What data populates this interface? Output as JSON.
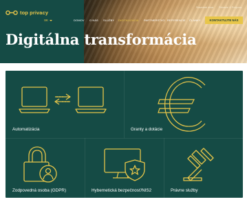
{
  "brand": {
    "name": "top privacy",
    "logo_icon": "key-icon",
    "accent": "#e8c64a",
    "primary": "#154b45"
  },
  "language": {
    "current": "SK",
    "icon": "chevron-down-icon"
  },
  "utility_links": [
    "Stavebné útvar",
    "Pátranie & Podpora"
  ],
  "nav": {
    "items": [
      {
        "label": "DOMOV",
        "active": false
      },
      {
        "label": "O NÁS",
        "active": false
      },
      {
        "label": "SLUŽBY",
        "active": false
      },
      {
        "label": "DIGITALIZÁCIA",
        "active": true
      },
      {
        "label": "PARTNERSTVO",
        "active": false
      },
      {
        "label": "REFERENCIE",
        "active": false
      },
      {
        "label": "ČLÁNKY",
        "active": false
      }
    ],
    "cta": "KONTAKTUJTE NÁS"
  },
  "hero": {
    "title": "Digitálna transformácia"
  },
  "cards": [
    {
      "label": "Automatizácia",
      "icon": "laptop-sync-icon"
    },
    {
      "label": "Granty a dotácie",
      "icon": "euro-icon"
    },
    {
      "label": "Zodpovedná osoba (GDPR)",
      "icon": "lock-person-icon"
    },
    {
      "label": "Hybernetická bezpečnosť/NIS2",
      "icon": "monitor-shield-star-icon"
    },
    {
      "label": "Právne služby",
      "icon": "gavel-icon"
    }
  ]
}
